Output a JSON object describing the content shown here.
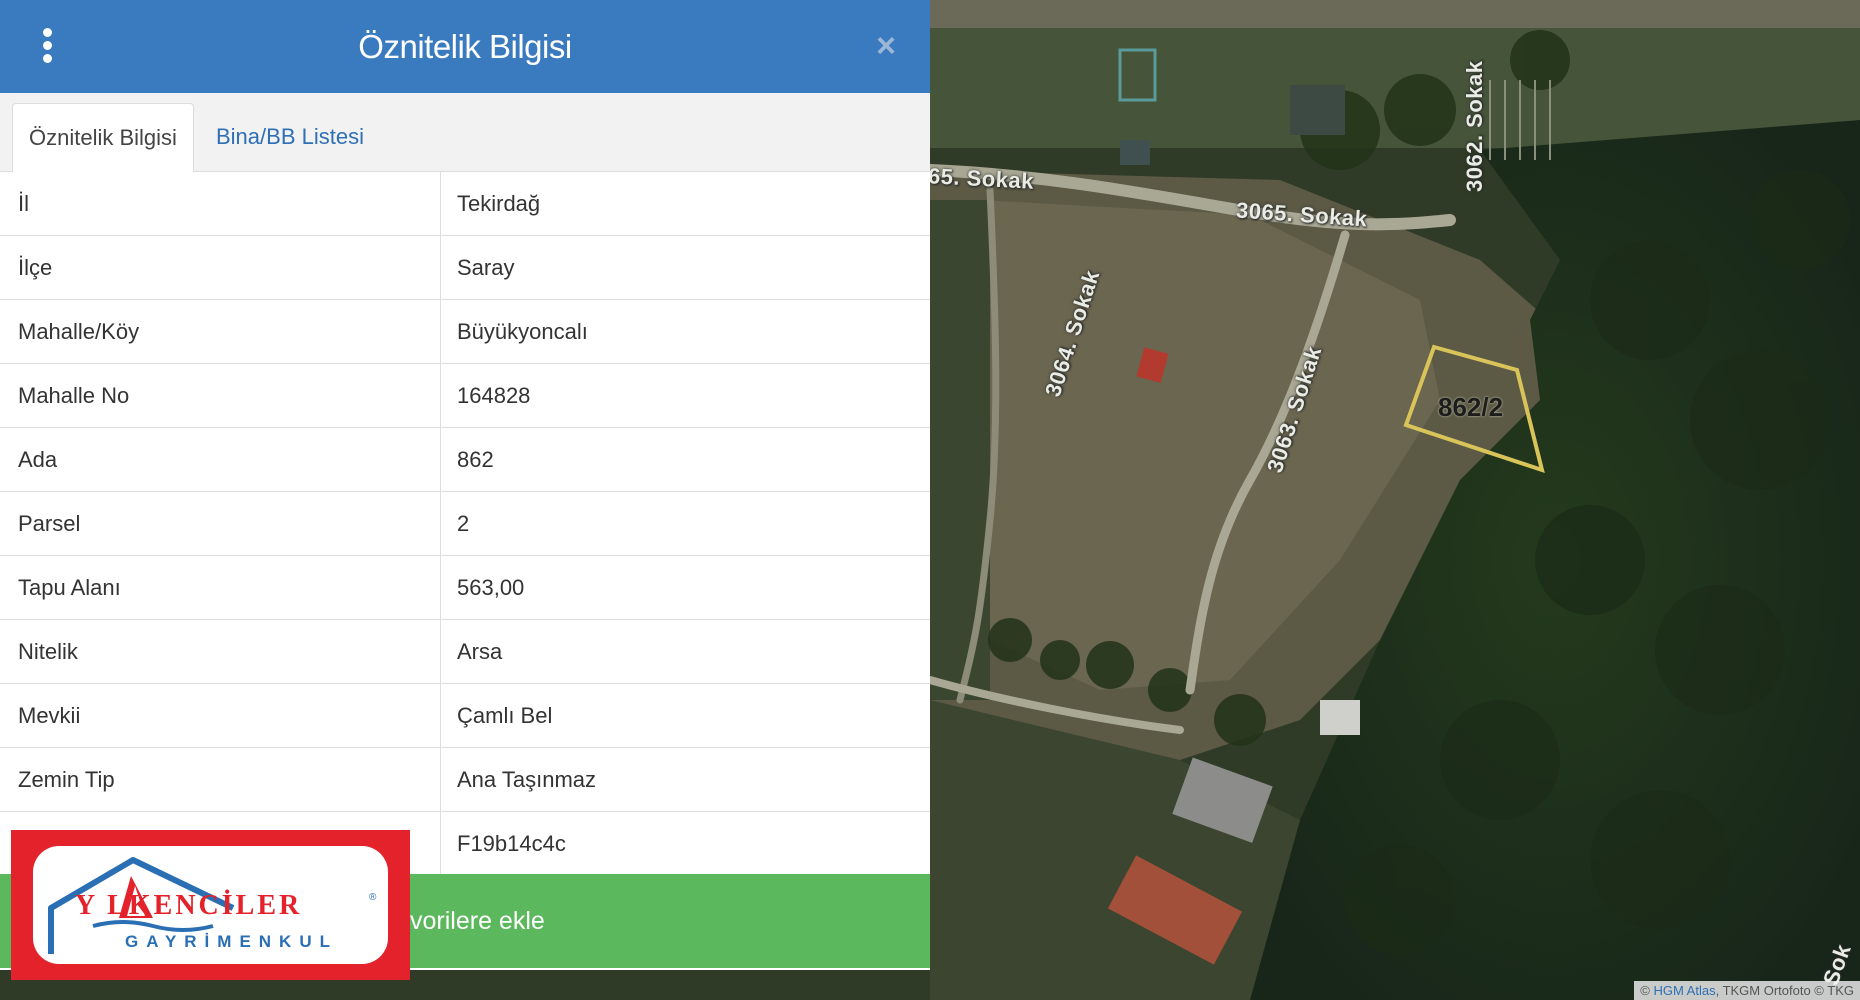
{
  "map": {
    "streets": [
      "65. Sokak",
      "3065. Sokak",
      "3062. Sokak",
      "3064. Sokak",
      "3063. Sokak",
      "Sok"
    ],
    "parcel_label": "862/2",
    "attribution_prefix": "© ",
    "attribution_link": "HGM Atlas",
    "attribution_rest": ", TKGM Ortofoto © TKG",
    "parcel_outline_color": "#d9c45a"
  },
  "panel": {
    "title": "Öznitelik Bilgisi",
    "menu_icon": "kebab-menu-icon",
    "close_icon": "close-icon",
    "tabs": [
      {
        "label": "Öznitelik Bilgisi",
        "active": true
      },
      {
        "label": "Bina/BB Listesi",
        "active": false
      }
    ],
    "rows": [
      {
        "key": "İl",
        "value": "Tekirdağ"
      },
      {
        "key": "İlçe",
        "value": "Saray"
      },
      {
        "key": "Mahalle/Köy",
        "value": "Büyükyoncalı"
      },
      {
        "key": "Mahalle No",
        "value": "164828"
      },
      {
        "key": "Ada",
        "value": "862"
      },
      {
        "key": "Parsel",
        "value": "2"
      },
      {
        "key": "Tapu Alanı",
        "value": "563,00"
      },
      {
        "key": "Nitelik",
        "value": "Arsa"
      },
      {
        "key": "Mevkii",
        "value": "Çamlı Bel"
      },
      {
        "key": "Zemin Tip",
        "value": "Ana Taşınmaz"
      },
      {
        "key": "",
        "value": "F19b14c4c"
      }
    ],
    "favorite_button": "vorilere ekle",
    "header_color": "#3a7abf",
    "favorite_color": "#5cb85c"
  },
  "logo": {
    "main": "Y LKENCİLER",
    "sub": "GAYRİMENKUL",
    "reg": "®",
    "frame_color": "#e3222b",
    "text_color": "#2a6fb3"
  }
}
